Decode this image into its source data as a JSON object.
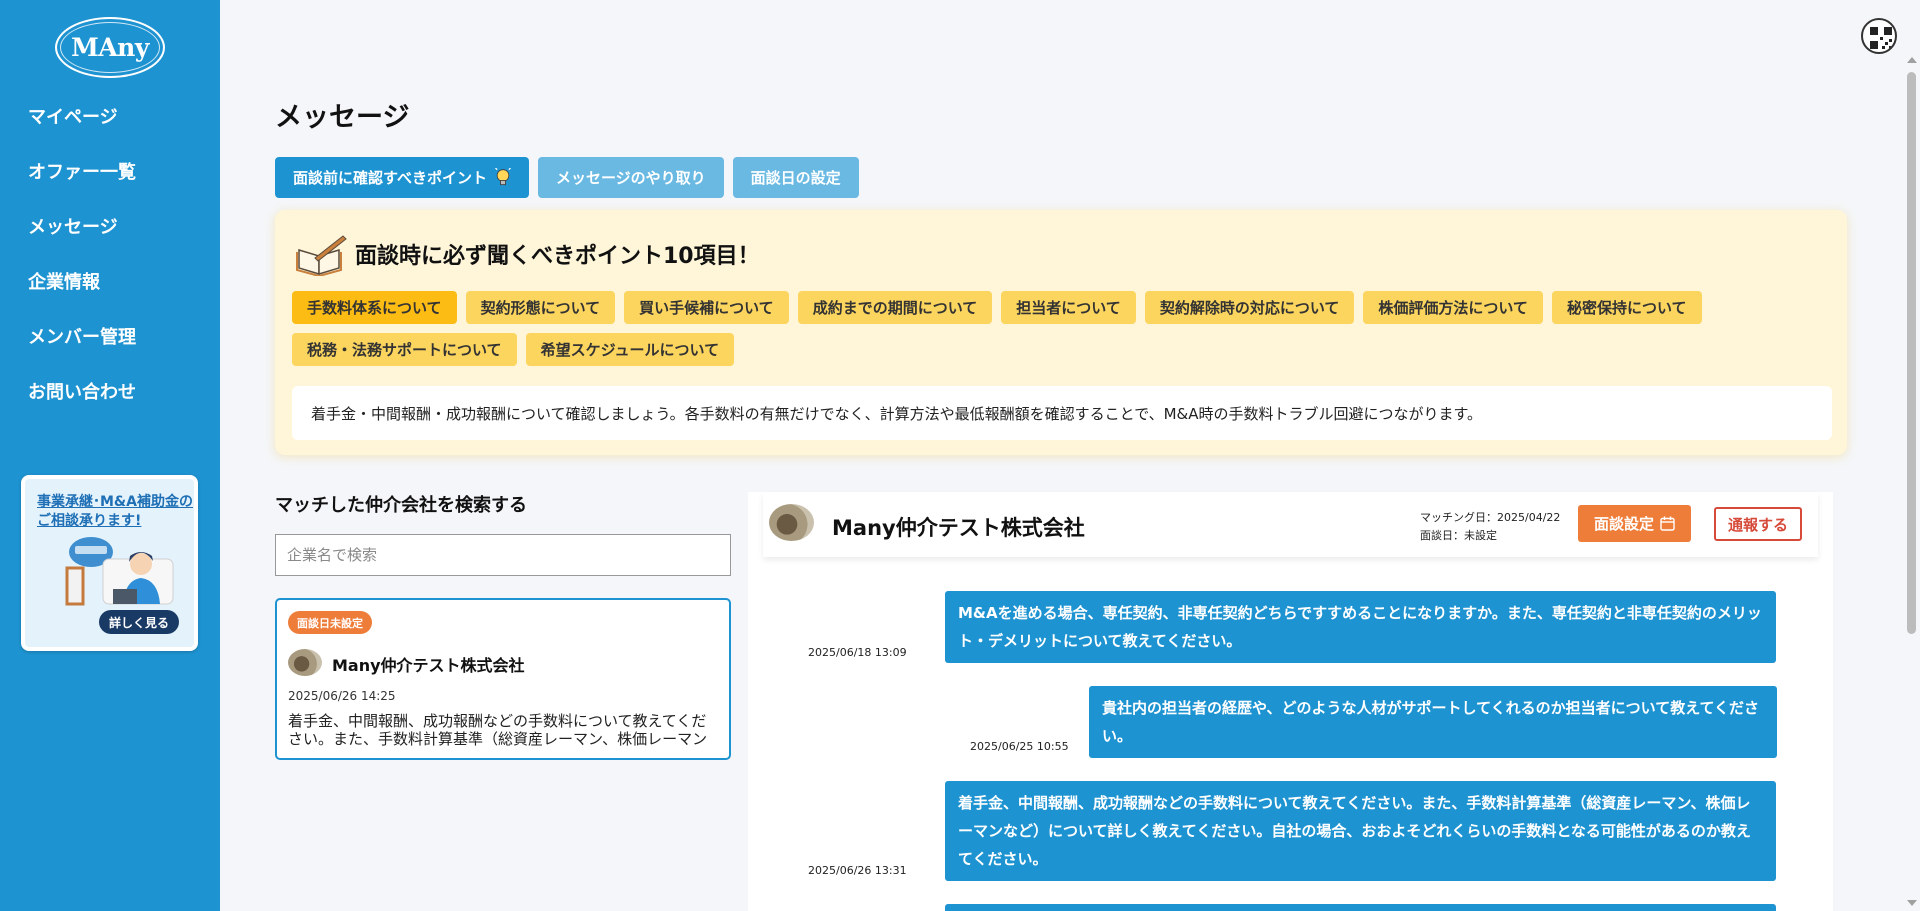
{
  "brand": {
    "logo_text": "MAny"
  },
  "sidebar": {
    "items": [
      {
        "label": "マイページ"
      },
      {
        "label": "オファー一覧"
      },
      {
        "label": "メッセージ"
      },
      {
        "label": "企業情報"
      },
      {
        "label": "メンバー管理"
      },
      {
        "label": "お問い合わせ"
      }
    ],
    "banner": {
      "text": "事業承継･M&A補助金のご相談承ります!",
      "button": "詳しく見る"
    }
  },
  "page": {
    "title": "メッセージ"
  },
  "tabs": [
    {
      "label": "面談前に確認すべきポイント",
      "active": true
    },
    {
      "label": "メッセージのやり取り",
      "active": false
    },
    {
      "label": "面談日の設定",
      "active": false
    }
  ],
  "points": {
    "title": "面談時に必ず聞くべきポイント10項目！",
    "chips": [
      {
        "label": "手数料体系について",
        "active": true
      },
      {
        "label": "契約形態について"
      },
      {
        "label": "買い手候補について"
      },
      {
        "label": "成約までの期間について"
      },
      {
        "label": "担当者について"
      },
      {
        "label": "契約解除時の対応について"
      },
      {
        "label": "株価評価方法について"
      },
      {
        "label": "秘密保持について"
      },
      {
        "label": "税務・法務サポートについて"
      },
      {
        "label": "希望スケジュールについて"
      }
    ],
    "description": "着手金・中間報酬・成功報酬について確認しましょう。各手数料の有無だけでなく、計算方法や最低報酬額を確認することで、M&A時の手数料トラブル回避につながります。"
  },
  "search": {
    "label": "マッチした仲介会社を検索する",
    "placeholder": "企業名で検索"
  },
  "conversation": {
    "badge": "面談日未設定",
    "company": "Many仲介テスト株式会社",
    "date": "2025/06/26 14:25",
    "preview": "着手金、中間報酬、成功報酬などの手数料について教えてください。また、手数料計算基準（総資産レーマン、株価レーマンなど）について詳しく教えてください。"
  },
  "chat": {
    "company": "Many仲介テスト株式会社",
    "matching_date": "マッチング日：2025/04/22",
    "meeting_date": "面談日：未設定",
    "meeting_button": "面談設定",
    "report_button": "通報する",
    "messages": [
      {
        "time": "2025/06/18 13:09",
        "text": "M&Aを進める場合、専任契約、非専任契約どちらですすめることになりますか。また、専任契約と非専任契約のメリット・デメリットについて教えてください。"
      },
      {
        "time": "2025/06/25 10:55",
        "text": "貴社内の担当者の経歴や、どのような人材がサポートしてくれるのか担当者について教えてください。"
      },
      {
        "time": "2025/06/26 13:31",
        "text": "着手金、中間報酬、成功報酬などの手数料について教えてください。また、手数料計算基準（総資産レーマン、株価レーマンなど）について詳しく教えてください。自社の場合、おおよそどれくらいの手数料となる可能性があるのか教えてください。"
      }
    ]
  },
  "colors": {
    "primary": "#1e93d1",
    "accent": "#ee7d3a",
    "chip": "#fcd55f",
    "chip_active": "#fdbc14",
    "alert": "#d64a3a",
    "points_bg": "#fff6d9"
  }
}
